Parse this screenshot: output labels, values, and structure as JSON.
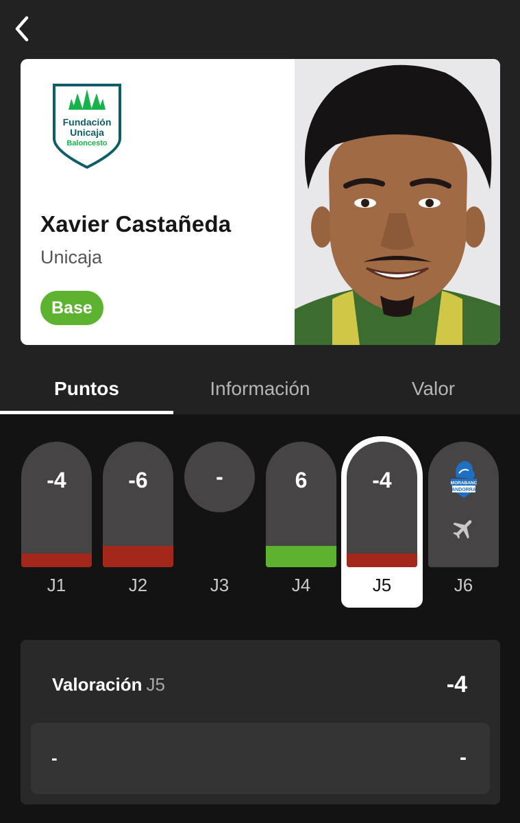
{
  "player": {
    "name": "Xavier Castañeda",
    "team": "Unicaja",
    "position": "Base",
    "team_logo_text": [
      "Fundación",
      "Unicaja",
      "Baloncesto"
    ]
  },
  "tabs": [
    {
      "label": "Puntos",
      "active": true
    },
    {
      "label": "Información",
      "active": false
    },
    {
      "label": "Valor",
      "active": false
    }
  ],
  "rounds": [
    {
      "label": "J1",
      "score": "-4",
      "status": "negative",
      "bar_color": "#a3271a",
      "bar_fill": 0.11
    },
    {
      "label": "J2",
      "score": "-6",
      "status": "negative",
      "bar_color": "#a3271a",
      "bar_fill": 0.17
    },
    {
      "label": "J3",
      "score": "-",
      "status": "no-play"
    },
    {
      "label": "J4",
      "score": "6",
      "status": "positive",
      "bar_color": "#5db32f",
      "bar_fill": 0.17
    },
    {
      "label": "J5",
      "score": "-4",
      "status": "negative",
      "bar_color": "#a3271a",
      "bar_fill": 0.11,
      "selected": true
    },
    {
      "label": "J6",
      "status": "upcoming-away",
      "opponent_logo_text": [
        "MORABANC",
        "ANDORRA"
      ],
      "icon": "airplane-icon"
    }
  ],
  "valoracion": {
    "title": "Valoración",
    "round": "J5",
    "score": "-4",
    "row_left": "-",
    "row_right": "-"
  },
  "colors": {
    "positive": "#5db32f",
    "negative": "#a3271a",
    "pill": "#464445",
    "header_bg": "#232223",
    "body_bg": "#141314"
  }
}
